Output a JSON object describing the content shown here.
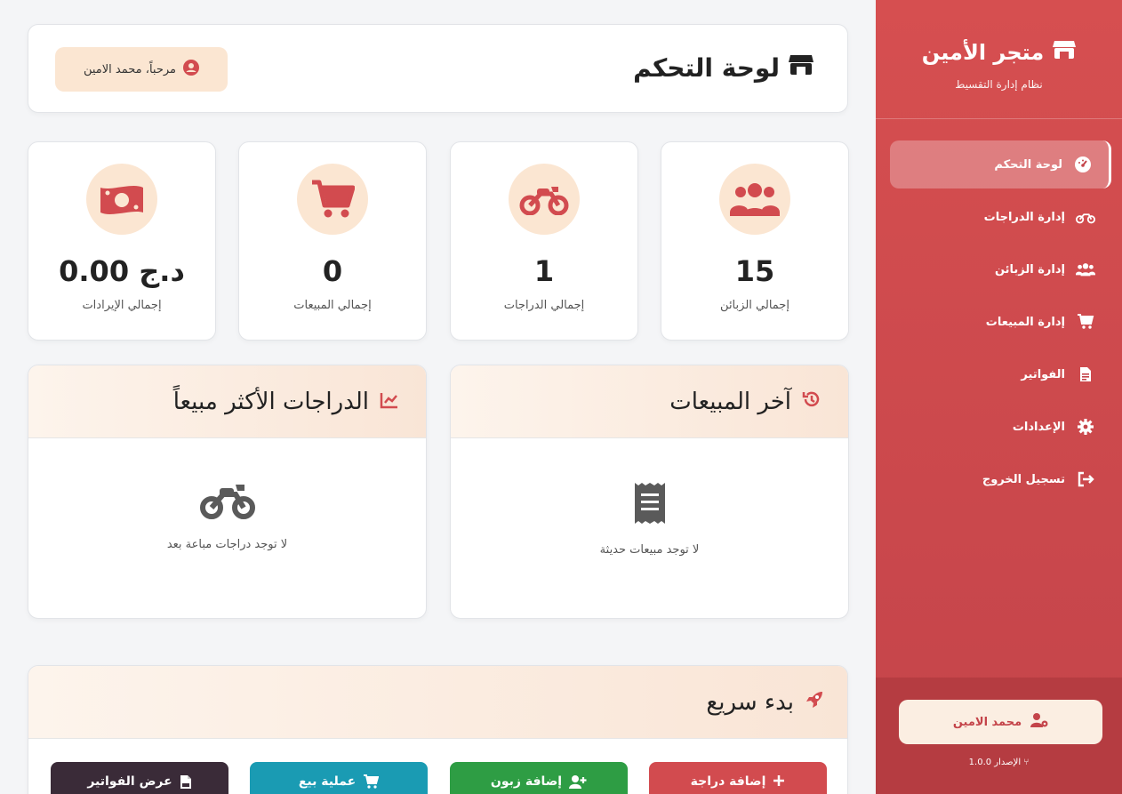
{
  "brand": {
    "title": "متجر الأمين",
    "subtitle": "نظام إدارة التقسيط"
  },
  "nav": [
    {
      "label": "لوحة التحكم",
      "icon": "dashboard-gauge-icon",
      "active": true
    },
    {
      "label": "إدارة الدراجات",
      "icon": "motorcycle-icon"
    },
    {
      "label": "إدارة الزبائن",
      "icon": "users-icon"
    },
    {
      "label": "إدارة المبيعات",
      "icon": "cart-icon"
    },
    {
      "label": "الفواتير",
      "icon": "invoice-icon"
    },
    {
      "label": "الإعدادات",
      "icon": "gear-icon"
    },
    {
      "label": "تسجيل الخروج",
      "icon": "logout-icon"
    }
  ],
  "sidebar_footer": {
    "user": "محمد الامين",
    "version": "الإصدار 1.0.0"
  },
  "header": {
    "title": "لوحة التحكم",
    "welcome": "مرحباً، محمد الامين"
  },
  "stats": [
    {
      "value": "15",
      "label": "إجمالي الزبائن",
      "icon": "users-icon"
    },
    {
      "value": "1",
      "label": "إجمالي الدراجات",
      "icon": "motorcycle-icon"
    },
    {
      "value": "0",
      "label": "إجمالي المبيعات",
      "icon": "cart-icon"
    },
    {
      "value": "د.ج 0.00",
      "label": "إجمالي الإيرادات",
      "icon": "money-icon"
    }
  ],
  "panels": {
    "recent_sales": {
      "title": "آخر المبيعات",
      "empty": "لا توجد مبيعات حديثة"
    },
    "top_bikes": {
      "title": "الدراجات الأكثر مبيعاً",
      "empty": "لا توجد دراجات مباعة بعد"
    }
  },
  "quick_start": {
    "title": "بدء سريع",
    "buttons": [
      {
        "label": "إضافة دراجة",
        "color": "#d24b4f"
      },
      {
        "label": "إضافة زبون",
        "color": "#2e9d44"
      },
      {
        "label": "عملية بيع",
        "color": "#1a9bb3"
      },
      {
        "label": "عرض الفواتير",
        "color": "#3a2b38"
      }
    ]
  },
  "colors": {
    "accent": "#d64f50",
    "accent_dark": "#b53c41",
    "soft": "#fbe6d2"
  }
}
